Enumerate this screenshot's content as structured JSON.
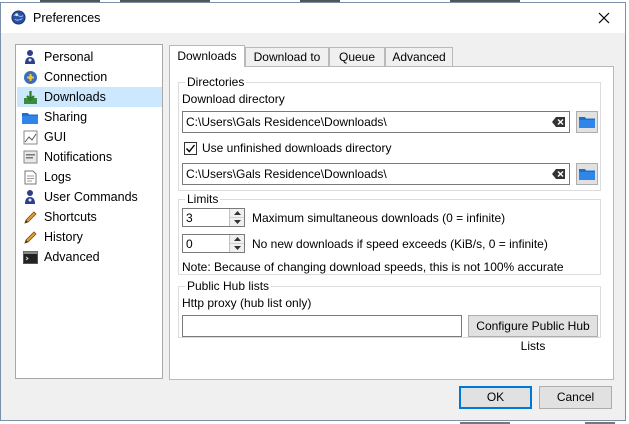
{
  "window": {
    "title": "Preferences"
  },
  "sidebar": {
    "items": [
      {
        "label": "Personal",
        "icon": "person-icon"
      },
      {
        "label": "Connection",
        "icon": "connection-icon"
      },
      {
        "label": "Downloads",
        "icon": "download-icon",
        "selected": true
      },
      {
        "label": "Sharing",
        "icon": "folder-icon"
      },
      {
        "label": "GUI",
        "icon": "gui-icon"
      },
      {
        "label": "Notifications",
        "icon": "notifications-icon"
      },
      {
        "label": "Logs",
        "icon": "logs-icon"
      },
      {
        "label": "User Commands",
        "icon": "person-icon"
      },
      {
        "label": "Shortcuts",
        "icon": "pencil-icon"
      },
      {
        "label": "History",
        "icon": "pencil-icon"
      },
      {
        "label": "Advanced",
        "icon": "terminal-icon"
      }
    ]
  },
  "tabs": [
    {
      "label": "Downloads",
      "active": true
    },
    {
      "label": "Download to"
    },
    {
      "label": "Queue"
    },
    {
      "label": "Advanced"
    }
  ],
  "directories": {
    "group_title": "Directories",
    "download_dir_label": "Download directory",
    "download_dir_value": "C:\\Users\\Gals Residence\\Downloads\\",
    "unfinished_checkbox_label": "Use unfinished downloads directory",
    "unfinished_checked": true,
    "unfinished_dir_value": "C:\\Users\\Gals Residence\\Downloads\\"
  },
  "limits": {
    "group_title": "Limits",
    "max_downloads_value": "3",
    "max_downloads_label": "Maximum simultaneous downloads (0 = infinite)",
    "speed_value": "0",
    "speed_label": "No new downloads if speed exceeds (KiB/s, 0 = infinite)",
    "note": "Note: Because of changing download speeds, this is not 100% accurate"
  },
  "hublists": {
    "group_title": "Public Hub lists",
    "proxy_label": "Http proxy (hub list only)",
    "proxy_value": "",
    "configure_button": "Configure Public Hub Lists"
  },
  "buttons": {
    "ok": "OK",
    "cancel": "Cancel"
  },
  "colors": {
    "selection": "#cce8ff",
    "default_button_border": "#0078d7",
    "browse_icon": "#1e6fc8"
  }
}
